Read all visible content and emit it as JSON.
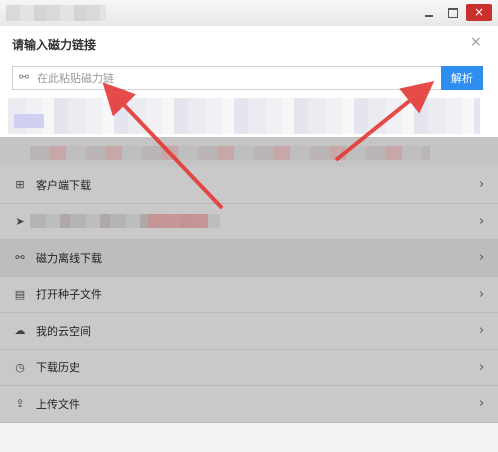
{
  "window": {
    "controls": {
      "minimize": "minimize-icon",
      "maximize": "maximize-icon",
      "close": "close-icon",
      "close_glyph": "×"
    }
  },
  "dialog": {
    "title": "请输入磁力链接",
    "close_glyph": "×",
    "input": {
      "placeholder": "在此粘贴磁力链",
      "value": "",
      "icon": "link-icon"
    },
    "parse_button": "解析"
  },
  "menu": {
    "items": [
      {
        "label": "客户端下载",
        "icon": "windows-icon",
        "glyph": "⊞",
        "active": false
      },
      {
        "label": "",
        "icon": "send-icon",
        "glyph": "➤",
        "active": false,
        "blurred": true
      },
      {
        "label": "磁力离线下载",
        "icon": "link-icon",
        "glyph": "⚯",
        "active": true
      },
      {
        "label": "打开种子文件",
        "icon": "file-icon",
        "glyph": "▤",
        "active": false
      },
      {
        "label": "我的云空间",
        "icon": "cloud-icon",
        "glyph": "☁",
        "active": false
      },
      {
        "label": "下载历史",
        "icon": "history-icon",
        "glyph": "◷",
        "active": false
      },
      {
        "label": "上传文件",
        "icon": "upload-icon",
        "glyph": "⇪",
        "active": false
      }
    ],
    "chevron": "›"
  },
  "colors": {
    "accent": "#2e8ef0",
    "annotation_arrow": "#e53935",
    "overlay": "#c9c9c9"
  }
}
